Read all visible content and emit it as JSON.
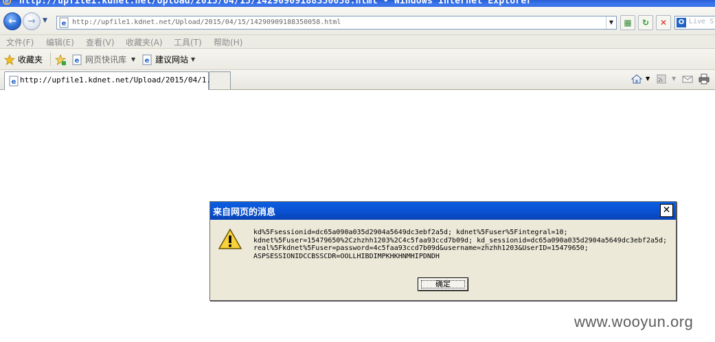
{
  "window": {
    "title": "http://upfile1.kdnet.net/Upload/2015/04/15/14290909188350058.html - Windows Internet Explorer"
  },
  "address_bar": {
    "url": "http://upfile1.kdnet.net/Upload/2015/04/15/14290909188350058.html",
    "search_placeholder": "Live S"
  },
  "menu": {
    "items": [
      {
        "label": "文件(F)"
      },
      {
        "label": "编辑(E)"
      },
      {
        "label": "查看(V)"
      },
      {
        "label": "收藏夹(A)"
      },
      {
        "label": "工具(T)"
      },
      {
        "label": "帮助(H)"
      }
    ]
  },
  "favorites_bar": {
    "favorites_label": "收藏夹",
    "links": [
      {
        "label": "网页快讯库"
      },
      {
        "label": "建议网站"
      }
    ]
  },
  "tabs": [
    {
      "label": "http://upfile1.kdnet.net/Upload/2015/04/1..."
    }
  ],
  "dialog": {
    "title": "来自网页的消息",
    "message": "kd%5Fsessionid=dc65a090a035d2904a5649dc3ebf2a5d; kdnet%5Fuser%5Fintegral=10;\nkdnet%5Fuser=15479650%2Czhzhh1203%2C4c5faa93ccd7b09d; kd_sessionid=dc65a090a035d2904a5649dc3ebf2a5d;\nreal%5Fkdnet%5Fuser=password=4c5faa93ccd7b09d&username=zhzhh1203&UserID=15479650;\nASPSESSIONIDCCBSSCDR=OOLLHIBDIMPKHKHNMHIPDNDH",
    "ok_label": "确定"
  },
  "watermark": "www.wooyun.org",
  "colors": {
    "title_bar": "#3a6fe2",
    "dialog_title": "#0a52d3",
    "dialog_bg": "#ece9d8",
    "chrome_bg": "#ecebe4"
  }
}
